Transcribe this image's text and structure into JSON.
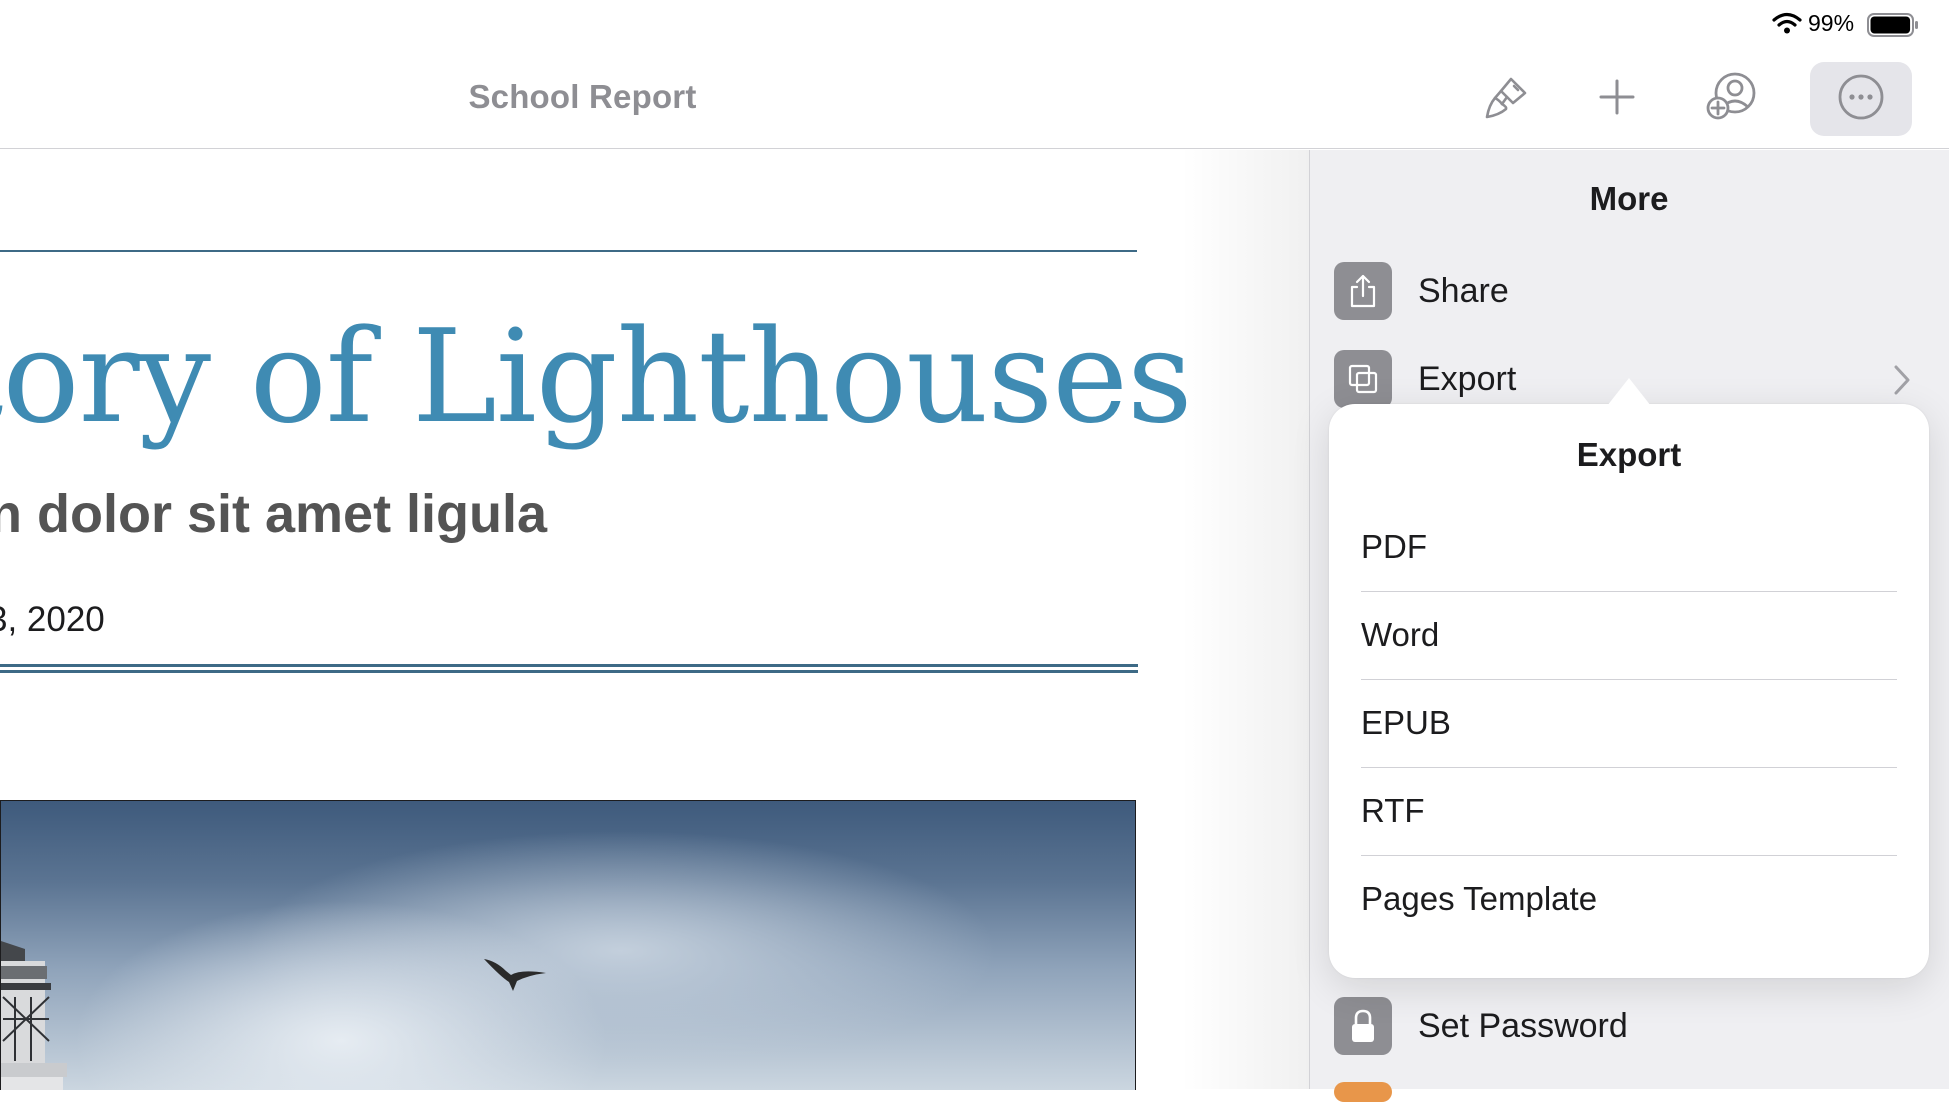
{
  "status_bar": {
    "battery_percent": "99%",
    "battery_level": 0.99,
    "wifi_icon": "wifi-icon",
    "battery_icon": "battery-icon"
  },
  "toolbar": {
    "document_title": "School Report",
    "icons": [
      "paintbrush-icon",
      "plus-icon",
      "add-collaborator-icon",
      "ellipsis-circle-icon"
    ]
  },
  "document": {
    "headline": "tory of Lighthouses",
    "subtitle": "n dolor sit amet ligula",
    "date": "3, 2020",
    "accent_color": "#3f8bb3"
  },
  "more_menu": {
    "title": "More",
    "items": [
      {
        "label": "Share",
        "icon": "share-icon"
      },
      {
        "label": "Export",
        "icon": "export-icon",
        "has_submenu": true
      },
      {
        "label": "Set Password",
        "icon": "lock-icon"
      }
    ]
  },
  "export_popover": {
    "title": "Export",
    "options": [
      "PDF",
      "Word",
      "EPUB",
      "RTF",
      "Pages Template"
    ]
  }
}
